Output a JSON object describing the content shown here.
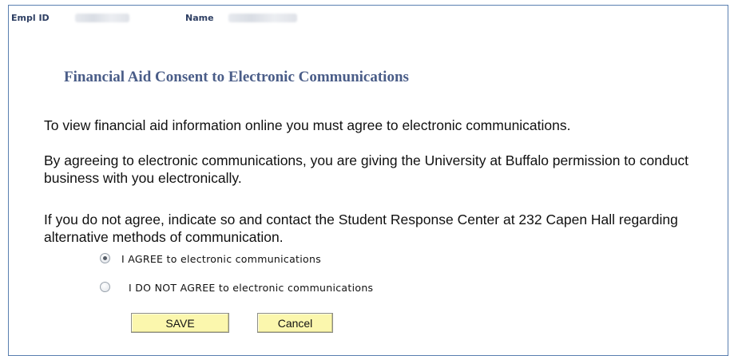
{
  "header": {
    "emplid_label": "Empl ID",
    "name_label": "Name"
  },
  "page": {
    "title": "Financial Aid Consent to Electronic Communications",
    "paragraphs": [
      "To view financial aid information online you must agree to electronic communications.",
      "By agreeing to electronic communications, you are giving the University at Buffalo permission to conduct business with you electronically.",
      "If you do not agree, indicate so and contact the Student Response Center at 232 Capen Hall regarding alternative methods of communication."
    ]
  },
  "consent_options": [
    {
      "label": "I AGREE to electronic communications",
      "selected": true
    },
    {
      "label": "I DO NOT AGREE to electronic communications",
      "selected": false
    }
  ],
  "buttons": {
    "save_label": "SAVE",
    "cancel_label": "Cancel"
  },
  "colors": {
    "title": "#4a5d88",
    "header_label": "#2e3f63",
    "button_bg": "#fbf7ad",
    "frame_border": "#5a7fb0"
  }
}
